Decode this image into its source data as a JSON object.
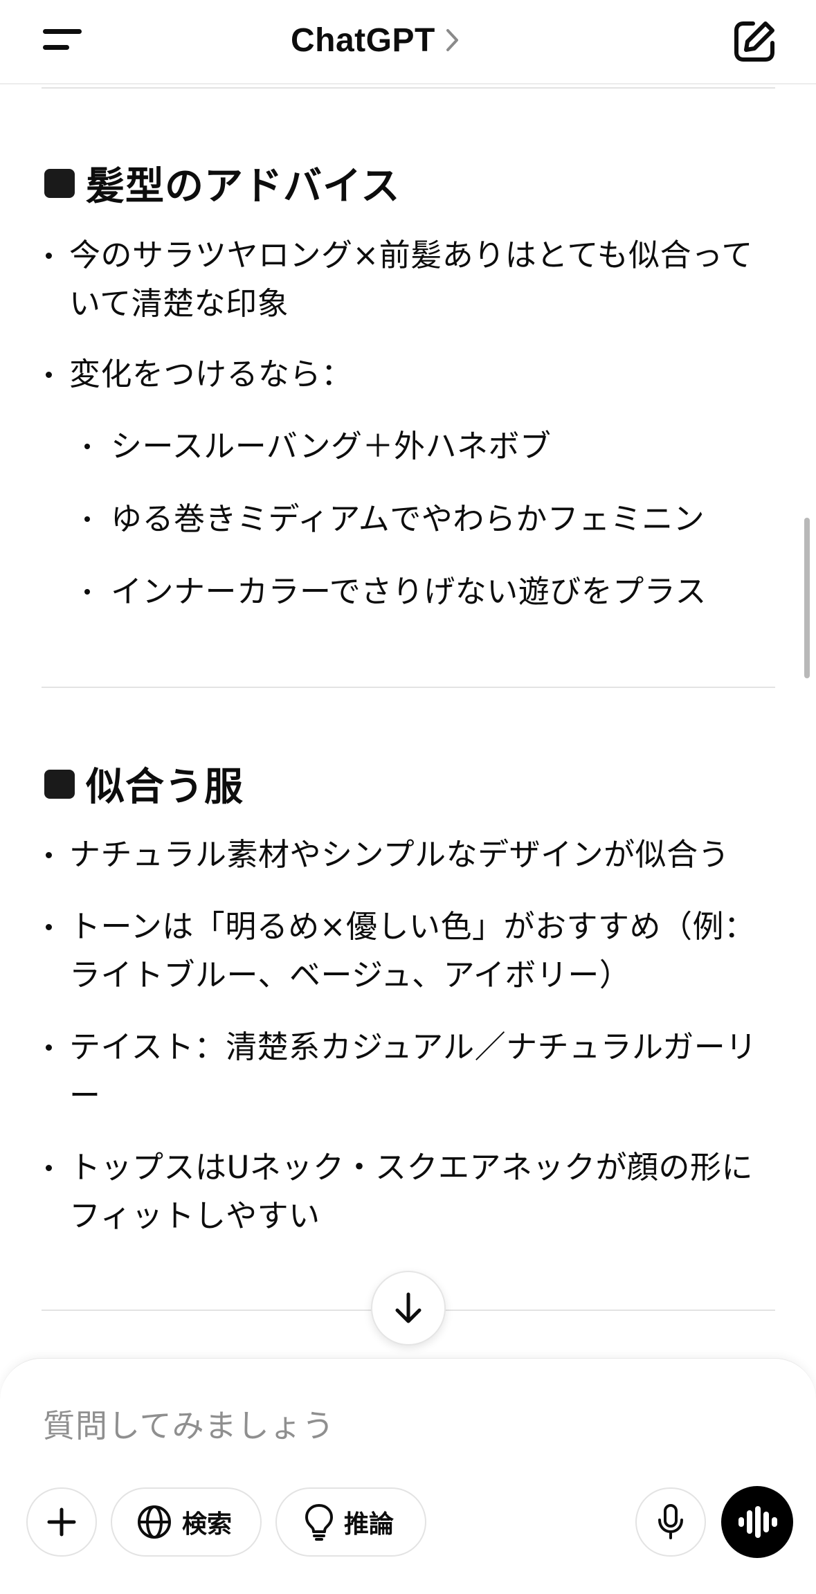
{
  "header": {
    "title": "ChatGPT"
  },
  "sections": [
    {
      "heading": "髪型のアドバイス",
      "items": [
        {
          "text": "今のサラツヤロング×前髪ありはとても似合っていて清楚な印象"
        },
        {
          "text": "変化をつけるなら："
        },
        {
          "text": "シースルーバング＋外ハネボブ"
        },
        {
          "text": "ゆる巻きミディアムでやわらかフェミニン"
        },
        {
          "text": "インナーカラーでさりげない遊びをプラス"
        }
      ]
    },
    {
      "heading": "似合う服",
      "items": [
        {
          "text": "ナチュラル素材やシンプルなデザインが似合う"
        },
        {
          "text": "トーンは「明るめ×優しい色」がおすすめ（例：ライトブルー、ベージュ、アイボリー）"
        },
        {
          "text": "テイスト：清楚系カジュアル／ナチュラルガーリー"
        },
        {
          "text": "トップスはUネック・スクエアネックが顔の形にフィットしやすい"
        }
      ]
    }
  ],
  "composer": {
    "placeholder": "質問してみましょう",
    "search_label": "検索",
    "reason_label": "推論"
  },
  "icons": {
    "menu": "menu-icon",
    "chevron": "chevron-right-icon",
    "new_chat": "new-chat-icon",
    "scroll_down": "arrow-down-icon",
    "plus": "plus-icon",
    "globe": "globe-icon",
    "bulb": "lightbulb-icon",
    "mic": "microphone-icon",
    "voice": "voice-waveform-icon"
  },
  "colors": {
    "text": "#0d0d0d",
    "placeholder": "#8f8f8f",
    "divider": "#e3e3e3",
    "voice_button": "#000000"
  }
}
